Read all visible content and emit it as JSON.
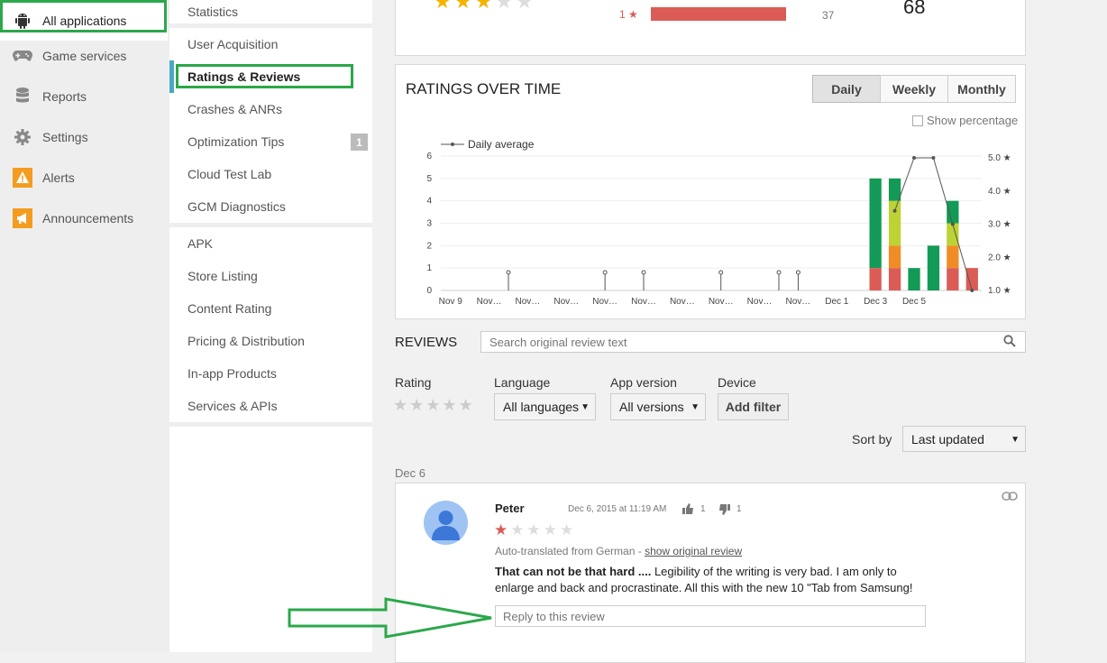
{
  "nav": {
    "items": [
      {
        "label": "All applications",
        "icon": "android-icon",
        "active": true
      },
      {
        "label": "Game services",
        "icon": "gamepad-icon"
      },
      {
        "label": "Reports",
        "icon": "database-icon"
      },
      {
        "label": "Settings",
        "icon": "gear-icon"
      },
      {
        "label": "Alerts",
        "icon": "warning-icon"
      },
      {
        "label": "Announcements",
        "icon": "megaphone-icon"
      }
    ]
  },
  "subnav": {
    "items": [
      {
        "label": "Statistics"
      },
      {
        "label": "User Acquisition"
      },
      {
        "label": "Ratings & Reviews",
        "active": true
      },
      {
        "label": "Crashes & ANRs"
      },
      {
        "label": "Optimization Tips",
        "badge": "1"
      },
      {
        "label": "Cloud Test Lab"
      },
      {
        "label": "GCM Diagnostics"
      },
      {
        "label": "APK"
      },
      {
        "label": "Store Listing"
      },
      {
        "label": "Content Rating"
      },
      {
        "label": "Pricing & Distribution"
      },
      {
        "label": "In-app Products"
      },
      {
        "label": "Services & APIs"
      }
    ]
  },
  "summary": {
    "one_star_label": "1",
    "one_star_count": "37",
    "total": "68",
    "one_star_share": 0.85
  },
  "chart": {
    "title": "RATINGS OVER TIME",
    "tabs": [
      "Daily",
      "Weekly",
      "Monthly"
    ],
    "active_tab": "Daily",
    "show_percentage_label": "Show percentage",
    "legend_label": "Daily average"
  },
  "chart_data": {
    "type": "bar",
    "stacked": true,
    "categories": [
      "Nov 9",
      "Nov 10",
      "Nov 11",
      "Nov 12",
      "Nov 13",
      "Nov 14",
      "Nov 15",
      "Nov 16",
      "Nov 17",
      "Nov 18",
      "Nov 19",
      "Nov 20",
      "Nov 21",
      "Nov 22",
      "Nov 23",
      "Nov 24",
      "Nov 25",
      "Nov 26",
      "Nov 27",
      "Nov 28",
      "Nov 29",
      "Nov 30",
      "Dec 1",
      "Dec 2",
      "Dec 3",
      "Dec 4",
      "Dec 5",
      "Dec 6"
    ],
    "x_tick_labels": [
      "Nov 9",
      "Nov…",
      "Nov…",
      "Nov…",
      "Nov…",
      "Nov…",
      "Nov…",
      "Nov…",
      "Nov…",
      "Nov…",
      "Dec 1",
      "Dec 3",
      "Dec 5"
    ],
    "series": [
      {
        "name": "1 star",
        "color": "#db5c56",
        "values": [
          0,
          0,
          0,
          0,
          0,
          0,
          0,
          0,
          0,
          0,
          0,
          0,
          0,
          0,
          0,
          0,
          0,
          0,
          0,
          0,
          0,
          0,
          1,
          1,
          0,
          0,
          1,
          1
        ]
      },
      {
        "name": "2 stars",
        "color": "#f08c25",
        "values": [
          0,
          0,
          0,
          0,
          0,
          0,
          0,
          0,
          0,
          0,
          0,
          0,
          0,
          0,
          0,
          0,
          0,
          0,
          0,
          0,
          0,
          0,
          0,
          1,
          0,
          0,
          1,
          0
        ]
      },
      {
        "name": "3 stars",
        "color": "#bdd235",
        "values": [
          0,
          0,
          0,
          0,
          0,
          0,
          0,
          0,
          0,
          0,
          0,
          0,
          0,
          0,
          0,
          0,
          0,
          0,
          0,
          0,
          0,
          0,
          0,
          2,
          0,
          0,
          1,
          0
        ]
      },
      {
        "name": "4 stars",
        "color": "#62b04a",
        "values": [
          0,
          0,
          0,
          0,
          0,
          0,
          0,
          0,
          0,
          0,
          0,
          0,
          0,
          0,
          0,
          0,
          0,
          0,
          0,
          0,
          0,
          0,
          0,
          0,
          0,
          0,
          0,
          0
        ]
      },
      {
        "name": "5 stars",
        "color": "#139a56",
        "values": [
          0,
          0,
          0,
          0,
          0,
          0,
          0,
          0,
          0,
          0,
          0,
          0,
          0,
          0,
          0,
          0,
          0,
          0,
          0,
          0,
          0,
          0,
          4,
          1,
          1,
          2,
          1,
          0
        ]
      }
    ],
    "daily_average": [
      null,
      null,
      null,
      null,
      null,
      null,
      null,
      null,
      null,
      null,
      null,
      null,
      null,
      null,
      null,
      null,
      null,
      null,
      null,
      null,
      null,
      null,
      null,
      3.4,
      5.0,
      5.0,
      3.0,
      1.0
    ],
    "empty_markers": [
      3,
      8,
      10,
      14,
      17,
      18
    ],
    "ylim": [
      0,
      6
    ],
    "y_ticks": [
      "0",
      "1",
      "2",
      "3",
      "4",
      "5",
      "6"
    ],
    "y2_ticks": [
      "1.0 ★",
      "2.0 ★",
      "3.0 ★",
      "4.0 ★",
      "5.0 ★"
    ],
    "grid": true,
    "legend_position": "top-left"
  },
  "reviews": {
    "title": "REVIEWS",
    "search_placeholder": "Search original review text",
    "filters": {
      "rating_label": "Rating",
      "language_label": "Language",
      "language_value": "All languages",
      "app_version_label": "App version",
      "app_version_value": "All versions",
      "device_label": "Device",
      "add_filter_label": "Add filter",
      "sort_label": "Sort by",
      "sort_value": "Last updated"
    },
    "date_header": "Dec 6",
    "review": {
      "author": "Peter",
      "date": "Dec 6, 2015 at 11:19 AM",
      "thumbs_up": "1",
      "thumbs_down": "1",
      "rating": 1,
      "translated_note": "Auto-translated from German - ",
      "show_original": "show original review",
      "title": "That can not be that hard ....",
      "body_line1": " Legibility of the writing is very bad. I am only to",
      "body_line2": "enlarge and back and procrastinate. All this with the new 10 \"Tab from Samsung!",
      "reply_placeholder": "Reply to this review"
    }
  },
  "colors": {
    "highlight": "#2ba84a",
    "one_star": "#db5c56",
    "accent": "#4a8fd6"
  }
}
